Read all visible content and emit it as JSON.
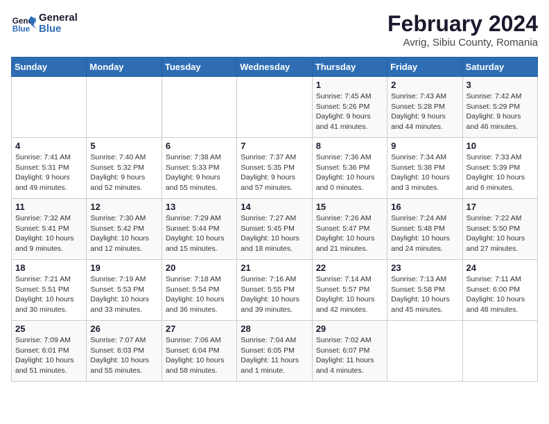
{
  "logo": {
    "line1": "General",
    "line2": "Blue"
  },
  "title": "February 2024",
  "subtitle": "Avrig, Sibiu County, Romania",
  "weekdays": [
    "Sunday",
    "Monday",
    "Tuesday",
    "Wednesday",
    "Thursday",
    "Friday",
    "Saturday"
  ],
  "weeks": [
    [
      {
        "day": "",
        "info": ""
      },
      {
        "day": "",
        "info": ""
      },
      {
        "day": "",
        "info": ""
      },
      {
        "day": "",
        "info": ""
      },
      {
        "day": "1",
        "info": "Sunrise: 7:45 AM\nSunset: 5:26 PM\nDaylight: 9 hours\nand 41 minutes."
      },
      {
        "day": "2",
        "info": "Sunrise: 7:43 AM\nSunset: 5:28 PM\nDaylight: 9 hours\nand 44 minutes."
      },
      {
        "day": "3",
        "info": "Sunrise: 7:42 AM\nSunset: 5:29 PM\nDaylight: 9 hours\nand 46 minutes."
      }
    ],
    [
      {
        "day": "4",
        "info": "Sunrise: 7:41 AM\nSunset: 5:31 PM\nDaylight: 9 hours\nand 49 minutes."
      },
      {
        "day": "5",
        "info": "Sunrise: 7:40 AM\nSunset: 5:32 PM\nDaylight: 9 hours\nand 52 minutes."
      },
      {
        "day": "6",
        "info": "Sunrise: 7:38 AM\nSunset: 5:33 PM\nDaylight: 9 hours\nand 55 minutes."
      },
      {
        "day": "7",
        "info": "Sunrise: 7:37 AM\nSunset: 5:35 PM\nDaylight: 9 hours\nand 57 minutes."
      },
      {
        "day": "8",
        "info": "Sunrise: 7:36 AM\nSunset: 5:36 PM\nDaylight: 10 hours\nand 0 minutes."
      },
      {
        "day": "9",
        "info": "Sunrise: 7:34 AM\nSunset: 5:38 PM\nDaylight: 10 hours\nand 3 minutes."
      },
      {
        "day": "10",
        "info": "Sunrise: 7:33 AM\nSunset: 5:39 PM\nDaylight: 10 hours\nand 6 minutes."
      }
    ],
    [
      {
        "day": "11",
        "info": "Sunrise: 7:32 AM\nSunset: 5:41 PM\nDaylight: 10 hours\nand 9 minutes."
      },
      {
        "day": "12",
        "info": "Sunrise: 7:30 AM\nSunset: 5:42 PM\nDaylight: 10 hours\nand 12 minutes."
      },
      {
        "day": "13",
        "info": "Sunrise: 7:29 AM\nSunset: 5:44 PM\nDaylight: 10 hours\nand 15 minutes."
      },
      {
        "day": "14",
        "info": "Sunrise: 7:27 AM\nSunset: 5:45 PM\nDaylight: 10 hours\nand 18 minutes."
      },
      {
        "day": "15",
        "info": "Sunrise: 7:26 AM\nSunset: 5:47 PM\nDaylight: 10 hours\nand 21 minutes."
      },
      {
        "day": "16",
        "info": "Sunrise: 7:24 AM\nSunset: 5:48 PM\nDaylight: 10 hours\nand 24 minutes."
      },
      {
        "day": "17",
        "info": "Sunrise: 7:22 AM\nSunset: 5:50 PM\nDaylight: 10 hours\nand 27 minutes."
      }
    ],
    [
      {
        "day": "18",
        "info": "Sunrise: 7:21 AM\nSunset: 5:51 PM\nDaylight: 10 hours\nand 30 minutes."
      },
      {
        "day": "19",
        "info": "Sunrise: 7:19 AM\nSunset: 5:53 PM\nDaylight: 10 hours\nand 33 minutes."
      },
      {
        "day": "20",
        "info": "Sunrise: 7:18 AM\nSunset: 5:54 PM\nDaylight: 10 hours\nand 36 minutes."
      },
      {
        "day": "21",
        "info": "Sunrise: 7:16 AM\nSunset: 5:55 PM\nDaylight: 10 hours\nand 39 minutes."
      },
      {
        "day": "22",
        "info": "Sunrise: 7:14 AM\nSunset: 5:57 PM\nDaylight: 10 hours\nand 42 minutes."
      },
      {
        "day": "23",
        "info": "Sunrise: 7:13 AM\nSunset: 5:58 PM\nDaylight: 10 hours\nand 45 minutes."
      },
      {
        "day": "24",
        "info": "Sunrise: 7:11 AM\nSunset: 6:00 PM\nDaylight: 10 hours\nand 48 minutes."
      }
    ],
    [
      {
        "day": "25",
        "info": "Sunrise: 7:09 AM\nSunset: 6:01 PM\nDaylight: 10 hours\nand 51 minutes."
      },
      {
        "day": "26",
        "info": "Sunrise: 7:07 AM\nSunset: 6:03 PM\nDaylight: 10 hours\nand 55 minutes."
      },
      {
        "day": "27",
        "info": "Sunrise: 7:06 AM\nSunset: 6:04 PM\nDaylight: 10 hours\nand 58 minutes."
      },
      {
        "day": "28",
        "info": "Sunrise: 7:04 AM\nSunset: 6:05 PM\nDaylight: 11 hours\nand 1 minute."
      },
      {
        "day": "29",
        "info": "Sunrise: 7:02 AM\nSunset: 6:07 PM\nDaylight: 11 hours\nand 4 minutes."
      },
      {
        "day": "",
        "info": ""
      },
      {
        "day": "",
        "info": ""
      }
    ]
  ]
}
